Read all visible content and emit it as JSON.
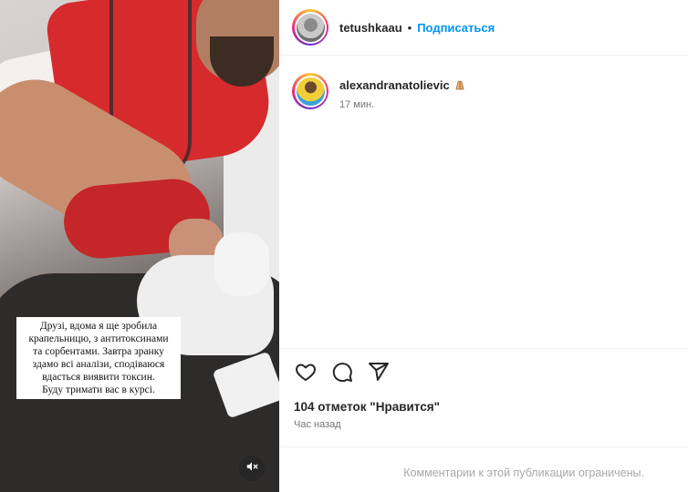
{
  "post": {
    "caption": "Друзі, вдома я ще зробила крапельницю, з антитоксинами та сорбентами. Завтра зранку здамо всі аналізи, сподіваюся вдасться виявити токсин. Буду тримати вас в курсі.",
    "caption_lines": "Друзі, вдома я ще зробила\nкрапельницю, з антитоксинами\nта сорбентами. Завтра зранку\nздамо всі аналізи, сподіваюся\nвдасться виявити токсин.\nБуду тримати вас в курсі.",
    "mute_icon": "speaker-muted-icon"
  },
  "header": {
    "username": "tetushkaau",
    "separator": "•",
    "follow_label": "Подписаться"
  },
  "comment": {
    "username": "alexandranatolievic",
    "emoji": "folded-hands-icon",
    "time": "17 мин."
  },
  "actions": {
    "like_icon": "heart-icon",
    "comment_icon": "comment-bubble-icon",
    "share_icon": "send-icon"
  },
  "likes": {
    "text": "104 отметок \"Нравится\""
  },
  "posted": {
    "time": "Час назад"
  },
  "comments_notice": {
    "text": "Комментарии к этой публикации ограничены."
  },
  "colors": {
    "accent": "#0095f6",
    "muted_text": "#737373",
    "disabled_text": "#a8a8a8"
  }
}
